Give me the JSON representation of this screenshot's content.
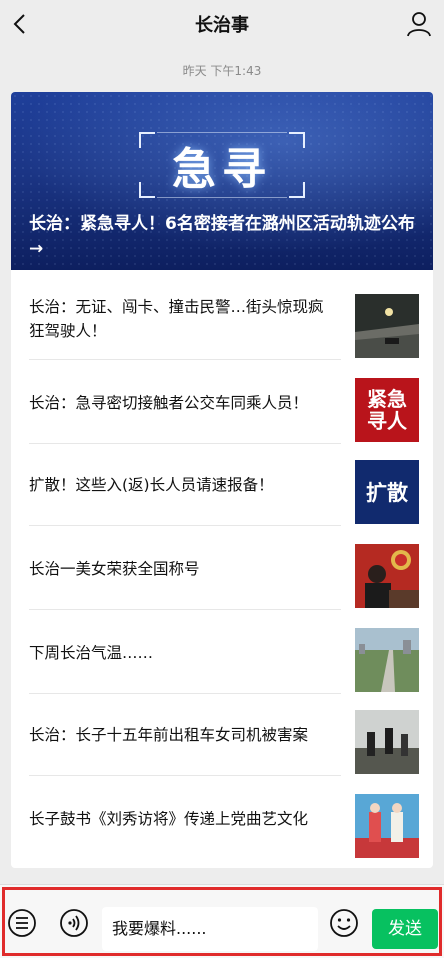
{
  "header": {
    "title": "长治事",
    "back_icon": "back-chevron-icon",
    "profile_icon": "person-icon"
  },
  "timestamp": "昨天 下午1:43",
  "hero": {
    "badge_word": "急寻",
    "title": "长治：紧急寻人！6名密接者在潞州区活动轨迹公布→"
  },
  "articles": [
    {
      "title": "长治：无证、闯卡、撞击民警…街头惊现疯狂驾驶人！",
      "thumb_text": ""
    },
    {
      "title": "长治：急寻密切接触者公交车同乘人员！",
      "thumb_text": "紧急寻人"
    },
    {
      "title": "扩散！这些入(返)长人员请速报备！",
      "thumb_text": "扩散"
    },
    {
      "title": "长治一美女荣获全国称号",
      "thumb_text": ""
    },
    {
      "title": "下周长治气温……",
      "thumb_text": ""
    },
    {
      "title": "长治：长子十五年前出租车女司机被害案",
      "thumb_text": ""
    },
    {
      "title": "长子鼓书《刘秀访将》传递上党曲艺文化",
      "thumb_text": ""
    }
  ],
  "bottombar": {
    "menu_icon": "list-menu-icon",
    "voice_icon": "voice-icon",
    "input_placeholder": "我要爆料......",
    "emoji_icon": "emoji-icon",
    "send_label": "发送"
  },
  "colors": {
    "background": "#ededed",
    "send_button": "#07c160",
    "highlight_frame": "#e02b2b",
    "hero_blue": "#1b3585"
  }
}
